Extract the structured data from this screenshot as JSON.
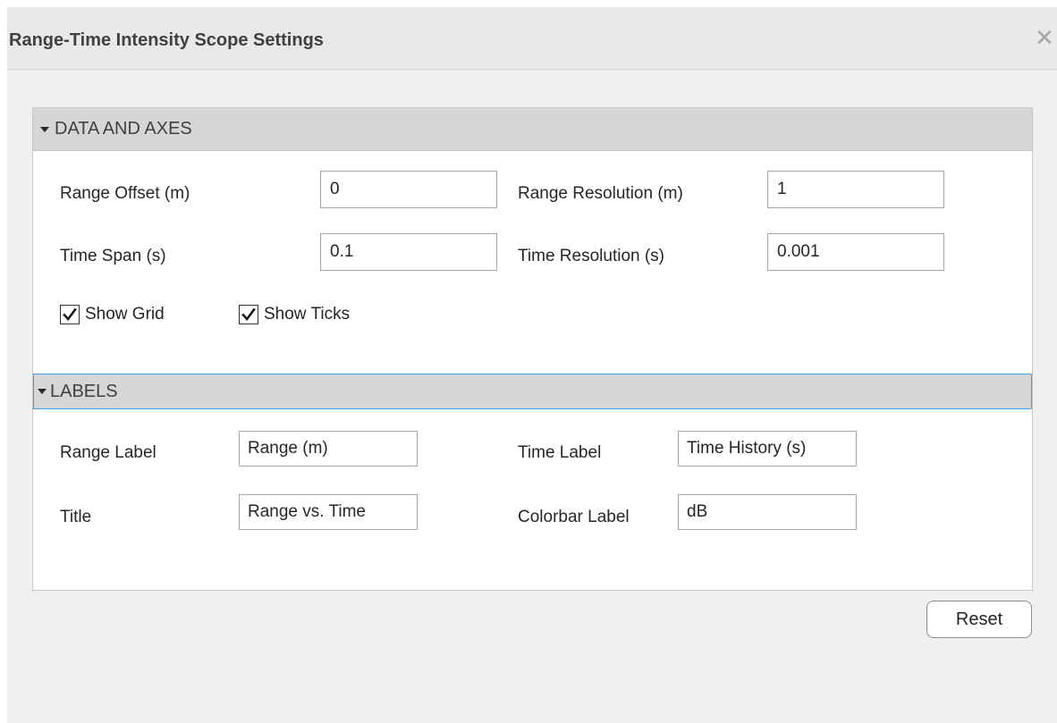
{
  "window": {
    "title": "Range-Time Intensity Scope Settings",
    "close_glyph": "✕"
  },
  "sections": {
    "data_axes": {
      "header": "DATA AND AXES",
      "range_offset": {
        "label": "Range Offset (m)",
        "value": "0"
      },
      "range_resolution": {
        "label": "Range Resolution (m)",
        "value": "1"
      },
      "time_span": {
        "label": "Time Span (s)",
        "value": "0.1"
      },
      "time_resolution": {
        "label": "Time Resolution (s)",
        "value": "0.001"
      },
      "show_grid": {
        "label": "Show Grid",
        "checked": true
      },
      "show_ticks": {
        "label": "Show Ticks",
        "checked": true
      }
    },
    "labels": {
      "header": "LABELS",
      "range_label": {
        "label": "Range Label",
        "value": "Range (m)"
      },
      "time_label": {
        "label": "Time Label",
        "value": "Time History (s)"
      },
      "title": {
        "label": "Title",
        "value": "Range vs. Time"
      },
      "colorbar_label": {
        "label": "Colorbar Label",
        "value": "dB"
      }
    }
  },
  "buttons": {
    "reset": "Reset"
  },
  "icons": {
    "close": "close-icon",
    "caret": "caret-down-icon",
    "check": "checkmark-icon"
  },
  "colors": {
    "focus_border": "#3ba0e8",
    "section_header_bg": "#d6d6d6"
  }
}
